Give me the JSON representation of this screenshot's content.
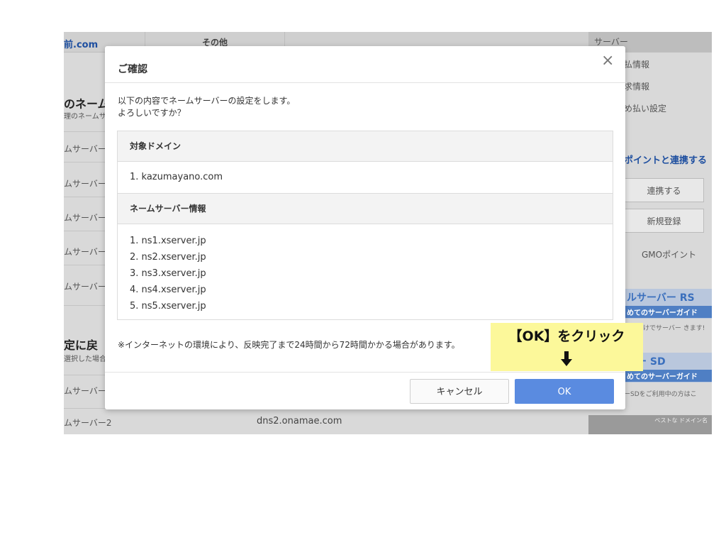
{
  "background_page": {
    "logo": "前.com",
    "header_tab": "その他",
    "right_header": "サーバー",
    "left_heading_1": "のネーム",
    "left_sub_1": "理のネームサ",
    "left_items": [
      "ムサーバー",
      "ムサーバー",
      "ムサーバー",
      "ムサーバー",
      "ムサーバー"
    ],
    "left_heading_2": "定に戻",
    "left_sub_2": "選択した場合",
    "left_item_bottom_1": "ムサーバー",
    "left_item_bottom_2": "ムサーバー2",
    "bottom_value": "dns2.onamae.com",
    "right_menu": [
      "払情報",
      "求情報",
      "め払い設定"
    ],
    "gmo_section_title": "ポイントと連携する",
    "link_button": "連携する",
    "register_button": "新規登録",
    "gmo_link": "GMOポイント",
    "banner_1_title": "ルサーバー RS",
    "banner_1_sub": "めてのサーバーガイド",
    "banner_1_note": "めるだけでサーバー きます!",
    "banner_2_title": "バー SD",
    "banner_2_sub": "めてのサーバーガイド",
    "banner_2_note": "ーSDをご利用中の方はこ",
    "photo_text": "ベストな ドメイン名"
  },
  "modal": {
    "title": "ご確認",
    "close_symbol": "×",
    "intro_line_1": "以下の内容でネームサーバーの設定をします。",
    "intro_line_2": "よろしいですか？",
    "domain_section_title": "対象ドメイン",
    "domain_item": "1. kazumayano.com",
    "ns_section_title": "ネームサーバー情報",
    "ns_items": [
      "1. ns1.xserver.jp",
      "2. ns2.xserver.jp",
      "3. ns3.xserver.jp",
      "4. ns4.xserver.jp",
      "5. ns5.xserver.jp"
    ],
    "note": "※インターネットの環境により、反映完了まで24時間から72時間かかる場合があります。",
    "cancel_label": "キャンセル",
    "ok_label": "OK"
  },
  "annotation": {
    "text": "【OK】をクリック",
    "arrow_icon": "down-arrow-icon",
    "background_color": "#fcf89a"
  },
  "colors": {
    "ok_button": "#5a8be0",
    "overlay_gray": "#d9d9d9"
  }
}
